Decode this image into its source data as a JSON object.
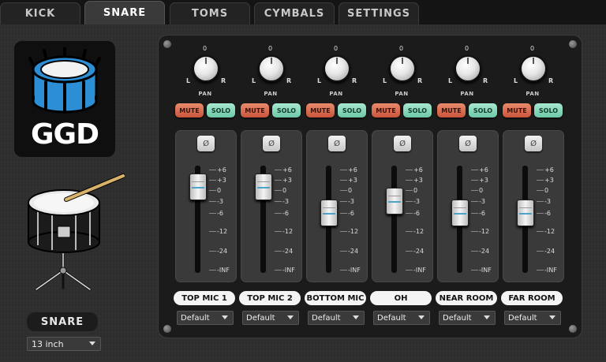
{
  "tabs": [
    {
      "label": "KICK",
      "active": false
    },
    {
      "label": "SNARE",
      "active": true
    },
    {
      "label": "TOMS",
      "active": false
    },
    {
      "label": "CYMBALS",
      "active": false
    },
    {
      "label": "SETTINGS",
      "active": false
    }
  ],
  "left_panel": {
    "logo_text": "GGD",
    "instrument_label": "SNARE",
    "size_select": "13 inch"
  },
  "channel_labels": {
    "pan": "PAN",
    "knob_zero": "0",
    "knob_left": "L",
    "knob_right": "R",
    "mute": "MUTE",
    "solo": "SOLO",
    "phase_icon": "Ø"
  },
  "fader_scale": [
    "+6",
    "+3",
    "0",
    "-3",
    "-6",
    "-12",
    "-24",
    "-INF"
  ],
  "channels": [
    {
      "name": "TOP MIC 1",
      "output": "Default",
      "fader_db": 1
    },
    {
      "name": "TOP MIC 2",
      "output": "Default",
      "fader_db": 1
    },
    {
      "name": "BOTTOM MIC",
      "output": "Default",
      "fader_db": -6
    },
    {
      "name": "OH",
      "output": "Default",
      "fader_db": -3
    },
    {
      "name": "NEAR ROOM",
      "output": "Default",
      "fader_db": -6
    },
    {
      "name": "FAR ROOM",
      "output": "Default",
      "fader_db": -6
    }
  ],
  "colors": {
    "mute": "#d9674b",
    "solo": "#8cd8bb",
    "logo_drum": "#2c8fd6"
  }
}
